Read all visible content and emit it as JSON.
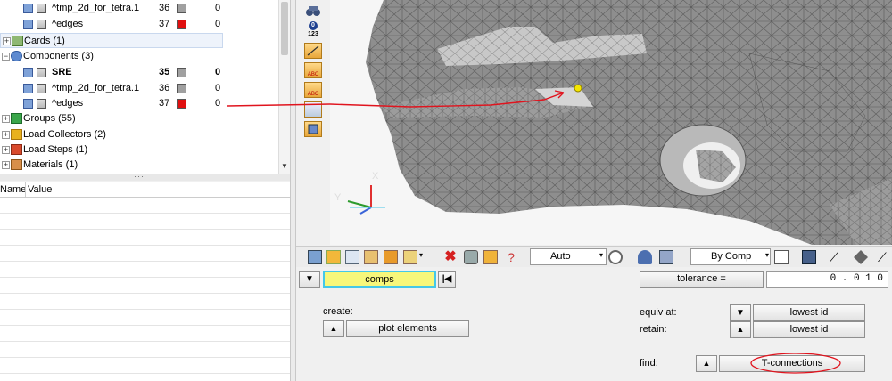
{
  "tree": {
    "rows_top": [
      {
        "name": "^tmp_2d_for_tetra.1",
        "id": "36",
        "color": "#a0a0a0",
        "include": "0"
      },
      {
        "name": "^edges",
        "id": "37",
        "color": "#e01010",
        "include": "0"
      }
    ],
    "cards": {
      "label": "Cards (1)"
    },
    "components": {
      "label": "Components (3)"
    },
    "comp_rows": [
      {
        "name": "SRE",
        "id": "35",
        "color": "#a0a0a0",
        "include": "0",
        "bold": true
      },
      {
        "name": "^tmp_2d_for_tetra.1",
        "id": "36",
        "color": "#a0a0a0",
        "include": "0"
      },
      {
        "name": "^edges",
        "id": "37",
        "color": "#e01010",
        "include": "0"
      }
    ],
    "categories": [
      {
        "label": "Groups (55)",
        "icon": "groups-icon"
      },
      {
        "label": "Load Collectors (2)",
        "icon": "load-collector-icon"
      },
      {
        "label": "Load Steps (1)",
        "icon": "load-step-icon"
      },
      {
        "label": "Materials (1)",
        "icon": "material-icon"
      }
    ]
  },
  "properties": {
    "col_name": "Name",
    "col_value": "Value"
  },
  "viewport": {
    "triad_x": "X",
    "triad_y": "Y",
    "node_color": "#f5e600",
    "annotation_color": "#e0141e"
  },
  "side_toolbar": {
    "counter_label": "123",
    "abc1": "ABC",
    "abc2": "ABC"
  },
  "toolbar": {
    "display_mode": "Auto",
    "color_mode": "By Comp"
  },
  "panel": {
    "entity_selector": "comps",
    "tolerance_button": "tolerance =",
    "tolerance_value": "0 . 0 1 0",
    "create_label": "create:",
    "create_value": "plot elements",
    "equiv_label": "equiv at:",
    "equiv_value": "lowest id",
    "retain_label": "retain:",
    "retain_value": "lowest id",
    "find_label": "find:",
    "find_value": "T-connections",
    "highlight_color": "#f7f77a"
  }
}
